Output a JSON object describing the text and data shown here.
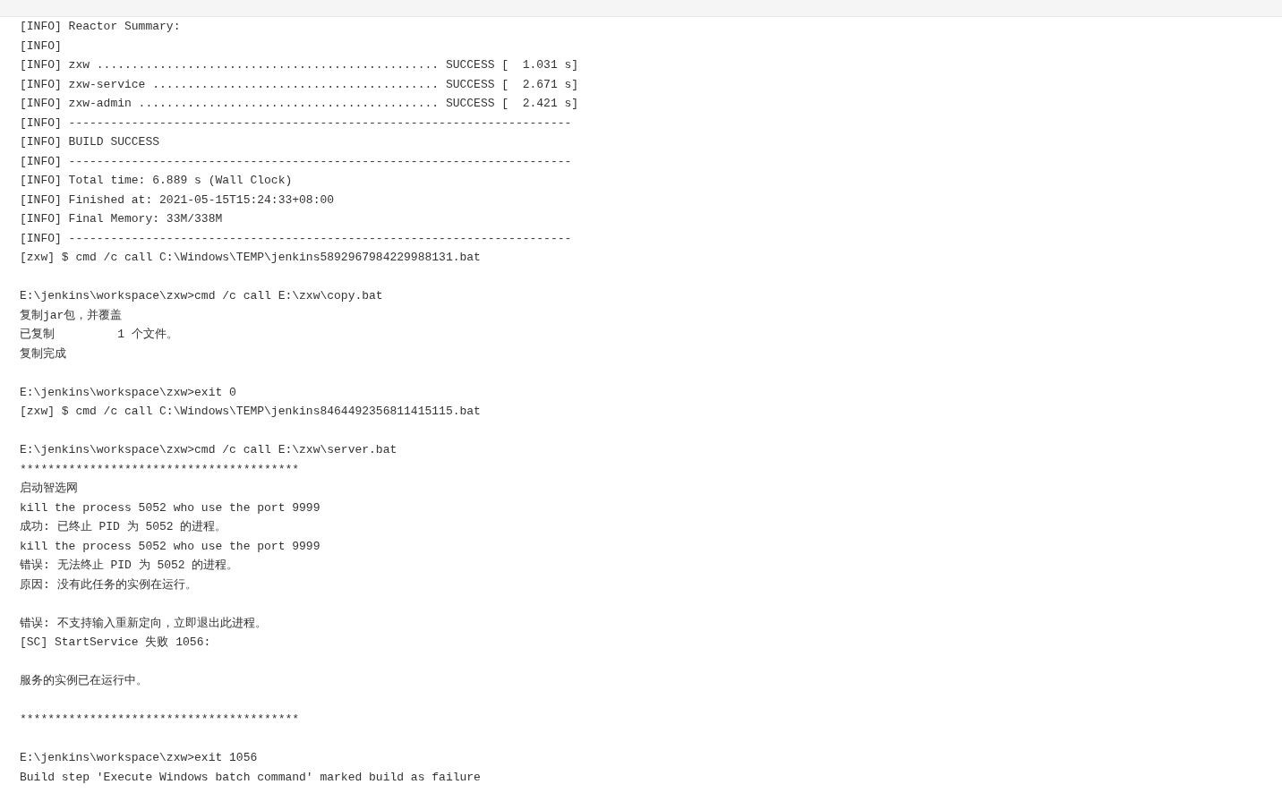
{
  "console": {
    "blocks": [
      [
        "[INFO] Reactor Summary:",
        "[INFO]",
        "[INFO] zxw ................................................. SUCCESS [  1.031 s]",
        "[INFO] zxw-service ......................................... SUCCESS [  2.671 s]",
        "[INFO] zxw-admin ........................................... SUCCESS [  2.421 s]",
        "[INFO] ------------------------------------------------------------------------",
        "[INFO] BUILD SUCCESS",
        "[INFO] ------------------------------------------------------------------------",
        "[INFO] Total time: 6.889 s (Wall Clock)",
        "[INFO] Finished at: 2021-05-15T15:24:33+08:00",
        "[INFO] Final Memory: 33M/338M",
        "[INFO] ------------------------------------------------------------------------",
        "[zxw] $ cmd /c call C:\\Windows\\TEMP\\jenkins5892967984229988131.bat"
      ],
      [
        "E:\\jenkins\\workspace\\zxw>cmd /c call E:\\zxw\\copy.bat",
        "复制jar包，并覆盖",
        "已复制         1 个文件。",
        "复制完成"
      ],
      [
        "E:\\jenkins\\workspace\\zxw>exit 0",
        "[zxw] $ cmd /c call C:\\Windows\\TEMP\\jenkins8464492356811415115.bat"
      ],
      [
        "E:\\jenkins\\workspace\\zxw>cmd /c call E:\\zxw\\server.bat",
        "****************************************",
        "启动智选网",
        "kill the process 5052 who use the port 9999",
        "成功: 已终止 PID 为 5052 的进程。",
        "kill the process 5052 who use the port 9999",
        "错误: 无法终止 PID 为 5052 的进程。",
        "原因: 没有此任务的实例在运行。"
      ],
      [
        "错误: 不支持输入重新定向，立即退出此进程。",
        "[SC] StartService 失败 1056:"
      ],
      [
        "服务的实例已在运行中。"
      ],
      [
        "****************************************"
      ],
      [
        "E:\\jenkins\\workspace\\zxw>exit 1056",
        "Build step 'Execute Windows batch command' marked build as failure"
      ]
    ]
  }
}
